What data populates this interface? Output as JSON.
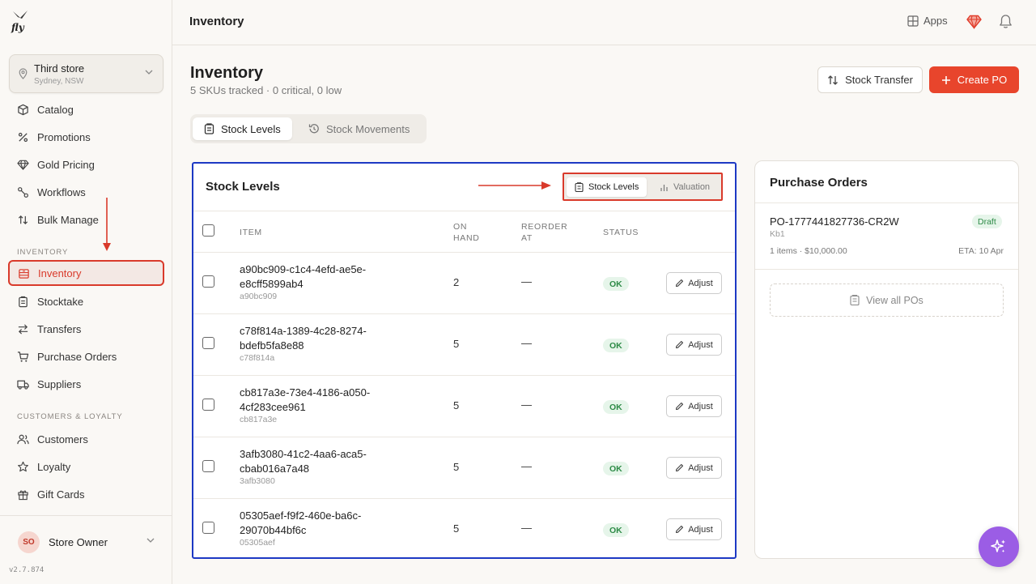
{
  "brand": {
    "logo_text": "fly"
  },
  "store": {
    "name": "Third store",
    "location": "Sydney, NSW"
  },
  "sidebar": {
    "items_top": [
      {
        "label": "Catalog",
        "icon": "box-icon"
      },
      {
        "label": "Promotions",
        "icon": "percent-icon"
      },
      {
        "label": "Gold Pricing",
        "icon": "gem-icon"
      },
      {
        "label": "Workflows",
        "icon": "workflow-icon"
      },
      {
        "label": "Bulk Manage",
        "icon": "sort-icon"
      }
    ],
    "section_inventory": "INVENTORY",
    "items_inventory": [
      {
        "label": "Inventory",
        "icon": "inventory-icon"
      },
      {
        "label": "Stocktake",
        "icon": "clipboard-icon"
      },
      {
        "label": "Transfers",
        "icon": "transfer-icon"
      },
      {
        "label": "Purchase Orders",
        "icon": "cart-icon"
      },
      {
        "label": "Suppliers",
        "icon": "truck-icon"
      }
    ],
    "section_customers": "CUSTOMERS & LOYALTY",
    "items_customers": [
      {
        "label": "Customers",
        "icon": "users-icon"
      },
      {
        "label": "Loyalty",
        "icon": "star-icon"
      },
      {
        "label": "Gift Cards",
        "icon": "gift-icon"
      }
    ]
  },
  "user": {
    "initials": "SO",
    "name": "Store Owner"
  },
  "version": "v2.7.874",
  "topbar": {
    "title": "Inventory",
    "apps_label": "Apps"
  },
  "page": {
    "title": "Inventory",
    "subtitle": "5 SKUs tracked · 0 critical, 0 low",
    "stock_transfer_label": "Stock Transfer",
    "create_po_label": "Create PO"
  },
  "tabs": {
    "stock_levels": "Stock Levels",
    "stock_movements": "Stock Movements"
  },
  "stock_card": {
    "title": "Stock Levels",
    "seg_stock_levels": "Stock Levels",
    "seg_valuation": "Valuation",
    "columns": {
      "item": "ITEM",
      "on_hand_1": "ON",
      "on_hand_2": "HAND",
      "reorder_1": "REORDER",
      "reorder_2": "AT",
      "status": "STATUS"
    },
    "adjust_label": "Adjust",
    "rows": [
      {
        "name_1": "a90bc909-c1c4-4efd-ae5e-",
        "name_2": "e8cff5899ab4",
        "sku": "a90bc909",
        "on_hand": "2",
        "reorder": "—",
        "status": "OK"
      },
      {
        "name_1": "c78f814a-1389-4c28-8274-",
        "name_2": "bdefb5fa8e88",
        "sku": "c78f814a",
        "on_hand": "5",
        "reorder": "—",
        "status": "OK"
      },
      {
        "name_1": "cb817a3e-73e4-4186-a050-",
        "name_2": "4cf283cee961",
        "sku": "cb817a3e",
        "on_hand": "5",
        "reorder": "—",
        "status": "OK"
      },
      {
        "name_1": "3afb3080-41c2-4aa6-aca5-",
        "name_2": "cbab016a7a48",
        "sku": "3afb3080",
        "on_hand": "5",
        "reorder": "—",
        "status": "OK"
      },
      {
        "name_1": "05305aef-f9f2-460e-ba6c-",
        "name_2": "29070b44bf6c",
        "sku": "05305aef",
        "on_hand": "5",
        "reorder": "—",
        "status": "OK"
      }
    ]
  },
  "purchase_orders": {
    "title": "Purchase Orders",
    "po_number": "PO-1777441827736-CR2W",
    "status": "Draft",
    "supplier": "Kb1",
    "summary": "1 items · $10,000.00",
    "eta": "ETA: 10 Apr",
    "view_all": "View all POs"
  },
  "colors": {
    "accent": "#e8452c",
    "annotation_blue": "#1d39c4",
    "annotation_red": "#d93a2b",
    "ok_green": "#2e8b47",
    "fab": "#9b5de5"
  }
}
